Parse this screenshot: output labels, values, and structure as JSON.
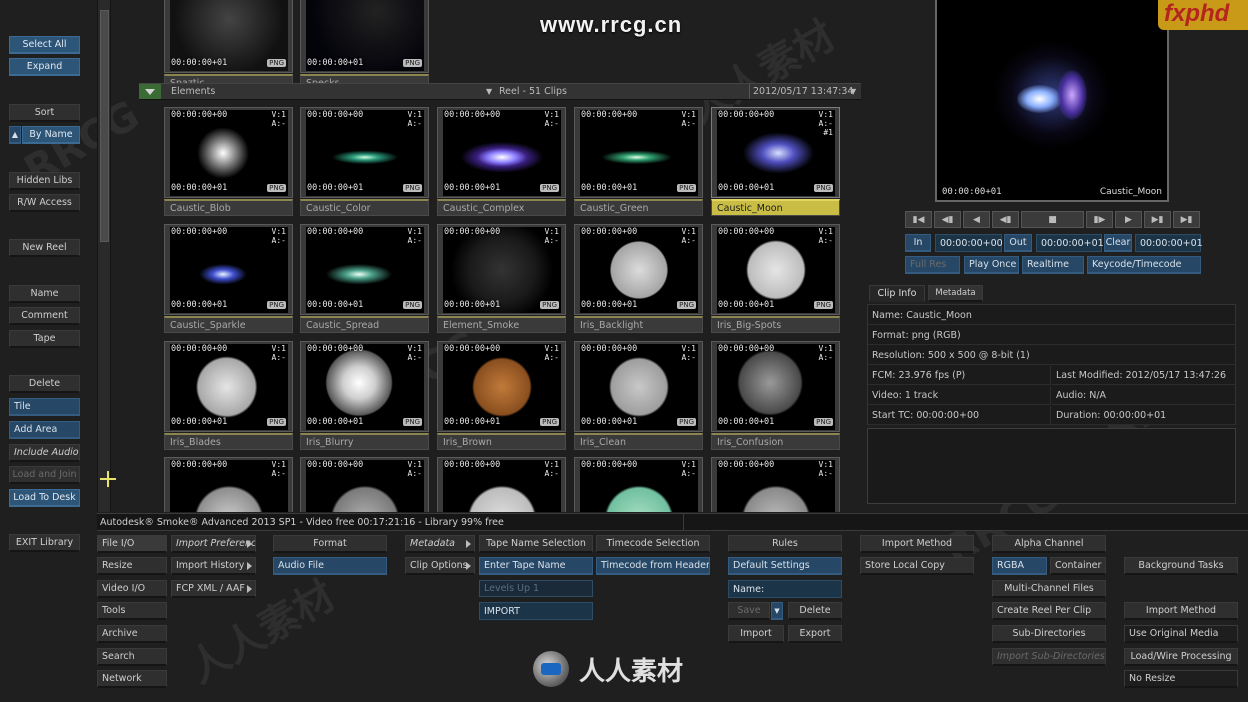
{
  "watermark_site": "www.rrcg.cn",
  "watermark_logo": "fxphd",
  "bottom_logo_text": "人人素材",
  "watermark_texts": [
    "RRCG",
    "人人素材"
  ],
  "left_panel": {
    "select_all": "Select All",
    "expand": "Expand",
    "sort": "Sort",
    "by_name": "By Name",
    "hidden_libs": "Hidden Libs",
    "rw_access": "R/W Access",
    "new_reel": "New Reel",
    "name": "Name",
    "comment": "Comment",
    "tape": "Tape",
    "delete": "Delete",
    "tile": "Tile",
    "add_area": "Add Area",
    "include_audio": "Include Audio",
    "load_and_join": "Load and Join",
    "load_to_desk": "Load To Desk",
    "exit_library": "EXIT Library"
  },
  "top_clips": [
    {
      "tc": "00:00:00+01",
      "fmt": "PNG",
      "label": "Spaztic"
    },
    {
      "tc": "00:00:00+01",
      "fmt": "PNG",
      "label": "Specks"
    }
  ],
  "reel_bar": {
    "name": "Elements",
    "reel": "Reel - 51 Clips",
    "date": "2012/05/17  13:47:34"
  },
  "clips": [
    {
      "label": "Caustic_Blob",
      "tc_in": "00:00:00+00",
      "tc_out": "00:00:00+01",
      "v": "V:1",
      "a": "A:-",
      "fmt": "PNG"
    },
    {
      "label": "Caustic_Color",
      "tc_in": "00:00:00+00",
      "tc_out": "00:00:00+01",
      "v": "V:1",
      "a": "A:-",
      "fmt": "PNG"
    },
    {
      "label": "Caustic_Complex",
      "tc_in": "00:00:00+00",
      "tc_out": "00:00:00+01",
      "v": "V:1",
      "a": "A:-",
      "fmt": "PNG"
    },
    {
      "label": "Caustic_Green",
      "tc_in": "00:00:00+00",
      "tc_out": "00:00:00+01",
      "v": "V:1",
      "a": "A:-",
      "fmt": "PNG"
    },
    {
      "label": "Caustic_Moon",
      "tc_in": "00:00:00+00",
      "tc_out": "00:00:00+01",
      "v": "V:1",
      "a": "A:-",
      "extra": "#1",
      "fmt": "PNG",
      "selected": true
    },
    {
      "label": "Caustic_Sparkle",
      "tc_in": "00:00:00+00",
      "tc_out": "00:00:00+01",
      "v": "V:1",
      "a": "A:-",
      "fmt": "PNG"
    },
    {
      "label": "Caustic_Spread",
      "tc_in": "00:00:00+00",
      "tc_out": "00:00:00+01",
      "v": "V:1",
      "a": "A:-",
      "fmt": "PNG"
    },
    {
      "label": "Element_Smoke",
      "tc_in": "00:00:00+00",
      "tc_out": "00:00:00+01",
      "v": "V:1",
      "a": "A:-",
      "fmt": "PNG"
    },
    {
      "label": "Iris_Backlight",
      "tc_in": "00:00:00+00",
      "tc_out": "00:00:00+01",
      "v": "V:1",
      "a": "A:-",
      "fmt": "PNG"
    },
    {
      "label": "Iris_Big-Spots",
      "tc_in": "00:00:00+00",
      "tc_out": "00:00:00+01",
      "v": "V:1",
      "a": "A:-",
      "fmt": "PNG"
    },
    {
      "label": "Iris_Blades",
      "tc_in": "00:00:00+00",
      "tc_out": "00:00:00+01",
      "v": "V:1",
      "a": "A:-",
      "fmt": "PNG"
    },
    {
      "label": "Iris_Blurry",
      "tc_in": "00:00:00+00",
      "tc_out": "00:00:00+01",
      "v": "V:1",
      "a": "A:-",
      "fmt": "PNG"
    },
    {
      "label": "Iris_Brown",
      "tc_in": "00:00:00+00",
      "tc_out": "00:00:00+01",
      "v": "V:1",
      "a": "A:-",
      "fmt": "PNG"
    },
    {
      "label": "Iris_Clean",
      "tc_in": "00:00:00+00",
      "tc_out": "00:00:00+01",
      "v": "V:1",
      "a": "A:-",
      "fmt": "PNG"
    },
    {
      "label": "Iris_Confusion",
      "tc_in": "00:00:00+00",
      "tc_out": "00:00:00+01",
      "v": "V:1",
      "a": "A:-",
      "fmt": "PNG"
    },
    {
      "tc_in": "00:00:00+00",
      "v": "V:1",
      "a": "A:-"
    },
    {
      "tc_in": "00:00:00+00",
      "v": "V:1",
      "a": "A:-"
    },
    {
      "tc_in": "00:00:00+00",
      "v": "V:1",
      "a": "A:-"
    },
    {
      "tc_in": "00:00:00+00",
      "v": "V:1",
      "a": "A:-"
    },
    {
      "tc_in": "00:00:00+00",
      "v": "V:1",
      "a": "A:-"
    }
  ],
  "viewer": {
    "tc": "00:00:00+01",
    "name": "Caustic_Moon"
  },
  "transport": {
    "in_label": "In",
    "in_tc": "00:00:00+00",
    "out_label": "Out",
    "out_tc": "00:00:00+01",
    "clear": "Clear",
    "clear_tc": "00:00:00+01",
    "full_res": "Full Res",
    "play_once": "Play Once",
    "realtime": "Realtime",
    "keycode": "Keycode/Timecode"
  },
  "info_tabs": {
    "clip_info": "Clip Info",
    "metadata": "Metadata"
  },
  "clip_info": {
    "name": "Name: Caustic_Moon",
    "format": "Format: png (RGB)",
    "resolution": "Resolution: 500 x 500 @ 8-bit (1)",
    "fcm": "FCM: 23.976 fps (P)",
    "last_modified": "Last Modified: 2012/05/17  13:47:26",
    "video": "Video: 1 track",
    "audio": "Audio: N/A",
    "start_tc": "Start TC: 00:00:00+00",
    "duration": "Duration: 00:00:00+01"
  },
  "status": "Autodesk® Smoke® Advanced 2013 SP1  - Video free 00:17:21:16 - Library 99% free",
  "bottom": {
    "file_io": "File I/O",
    "resize": "Resize",
    "video_io": "Video I/O",
    "tools": "Tools",
    "archive": "Archive",
    "search": "Search",
    "network": "Network",
    "import_preferences": "Import Preferences",
    "import_history": "Import History",
    "fcp_xml": "FCP XML / AAF",
    "format": "Format",
    "audio_file": "Audio File",
    "metadata": "Metadata",
    "clip_options": "Clip Options",
    "tape_name_selection": "Tape Name Selection",
    "enter_tape_name": "Enter Tape Name",
    "levels_up": "Levels Up 1",
    "import_field": "IMPORT",
    "timecode_selection": "Timecode Selection",
    "timecode_from_header": "Timecode from Header",
    "rules": "Rules",
    "default_settings": "Default Settings",
    "name_field": "Name:",
    "save": "Save",
    "delete": "Delete",
    "import": "Import",
    "export": "Export",
    "import_method": "Import Method",
    "store_local_copy": "Store Local Copy",
    "alpha_channel": "Alpha Channel",
    "rgba": "RGBA",
    "container": "Container",
    "multi_channel_files": "Multi-Channel Files",
    "create_reel_per_clip": "Create Reel Per Clip",
    "sub_directories": "Sub-Directories",
    "import_sub_directories": "Import Sub-Directories",
    "background_tasks": "Background Tasks",
    "import_method2": "Import Method",
    "use_original_media": "Use Original Media",
    "load_wire_processing": "Load/Wire Processing",
    "no_resize": "No Resize"
  }
}
